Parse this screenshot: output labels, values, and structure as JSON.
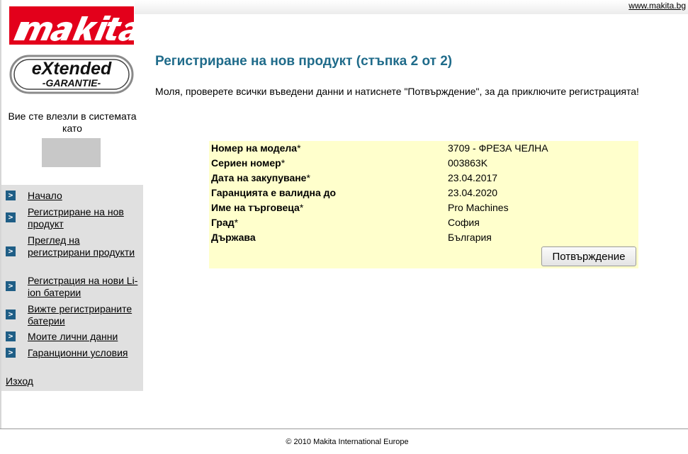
{
  "header": {
    "site_link": "www.makita.bg",
    "brand": "makita",
    "extended_logo_line1": "eXtended",
    "extended_logo_line2": "-GARANTIE-"
  },
  "sidebar": {
    "logged_in_text": "Вие сте влезли в системата като",
    "items": [
      {
        "label": "Начало"
      },
      {
        "label": "Регистриране на нов продукт"
      },
      {
        "label": "Преглед на регистрирани продукти"
      },
      {
        "label": "Регистрация на нови Li-ion батерии"
      },
      {
        "label": "Вижте регистрираните батерии"
      },
      {
        "label": "Моите лични данни"
      },
      {
        "label": "Гаранционни условия"
      }
    ],
    "logout_label": "Изход"
  },
  "main": {
    "title": "Регистриране на нов продукт (стъпка 2 от 2)",
    "instruction": "Моля, проверете всички въведени данни и натиснете \"Потвърждение\", за да приключите регистрацията!",
    "rows": [
      {
        "label": "Номер на модела",
        "required": "*",
        "value": "3709 - ФРЕЗА ЧЕЛНА"
      },
      {
        "label": "Сериен номер",
        "required": "*",
        "value": "003863K"
      },
      {
        "label": "Дата на закупуване",
        "required": "*",
        "value": "23.04.2017"
      },
      {
        "label": "Гаранцията е валидна до",
        "required": "",
        "value": "23.04.2020"
      },
      {
        "label": "Име на търговеца",
        "required": "*",
        "value": "Pro Machines"
      },
      {
        "label": "Град",
        "required": "*",
        "value": "София"
      },
      {
        "label": "Държава",
        "required": "",
        "value": "България"
      }
    ],
    "confirm_label": "Потвърждение"
  },
  "footer": {
    "copyright": "© 2010 Makita International Europe"
  },
  "colors": {
    "brand_red": "#e3001b",
    "title_blue": "#1f6b8a",
    "summary_bg": "#ffffcc",
    "sidebar_bg": "#e0e0e0"
  },
  "icons": {
    "nav_arrow": "chevron-right-icon"
  }
}
